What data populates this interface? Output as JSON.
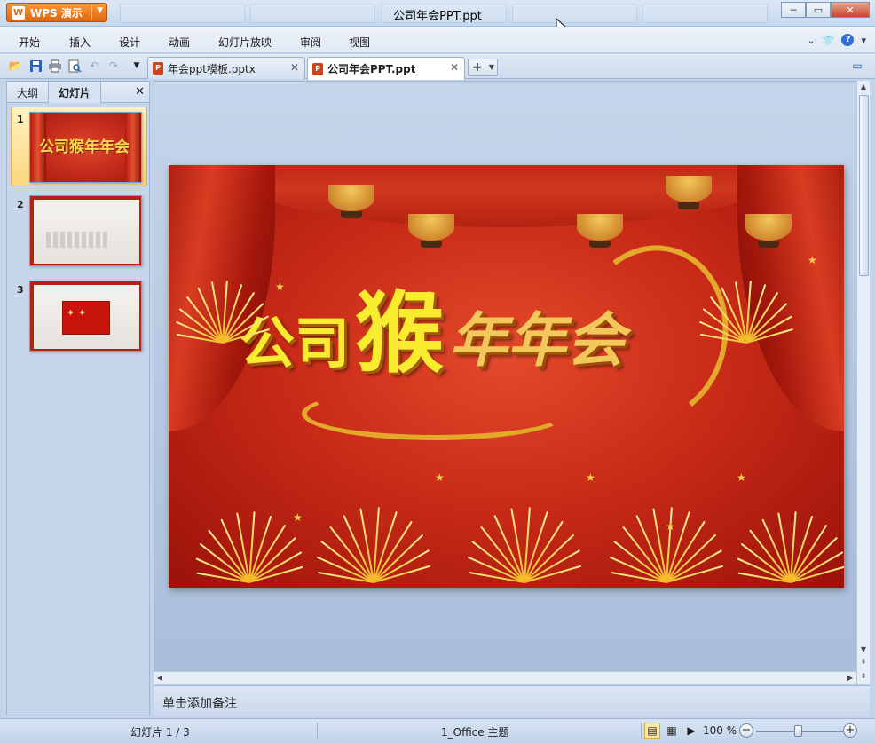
{
  "app": {
    "name": "WPS 演示",
    "logo_letter": "W",
    "window_title": "公司年会PPT.ppt"
  },
  "window_controls": {
    "minimize": "─",
    "maximize": "▭",
    "close": "✕"
  },
  "menu": {
    "items": [
      "开始",
      "插入",
      "设计",
      "动画",
      "幻灯片放映",
      "审阅",
      "视图"
    ]
  },
  "doc_tabs": [
    {
      "label": "年会ppt模板.pptx",
      "active": false
    },
    {
      "label": "公司年会PPT.ppt",
      "active": true
    }
  ],
  "new_tab_label": "+",
  "left_panel": {
    "tabs": [
      "大纲",
      "幻灯片"
    ],
    "active_tab": "幻灯片",
    "close": "✕",
    "thumbnails": [
      {
        "number": "1",
        "text": "公司猴年年会",
        "selected": true
      },
      {
        "number": "2",
        "text": "",
        "selected": false
      },
      {
        "number": "3",
        "text": "",
        "selected": false
      }
    ]
  },
  "slide": {
    "title_part1": "公司",
    "title_part2": "猴",
    "title_part3": "年年会"
  },
  "notes": {
    "placeholder": "单击添加备注"
  },
  "status": {
    "slide_info": "幻灯片 1 / 3",
    "theme": "1_Office 主题",
    "zoom": "100 %",
    "zoom_level": 0.5
  },
  "colors": {
    "accent_orange": "#e0660e",
    "slide_red": "#c92b17",
    "title_yellow": "#f9ec2f"
  }
}
